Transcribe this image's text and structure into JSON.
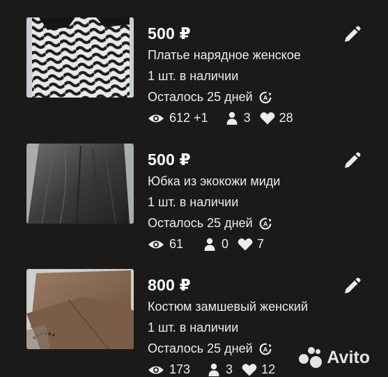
{
  "listings": [
    {
      "price": "500 ₽",
      "title": "Платье нарядное женское",
      "stock": "1 шт. в наличии",
      "remaining": "Осталось 25 дней",
      "views": "612 +1",
      "contacts": "3",
      "favorites": "28",
      "photo": "black-white-wave-dress-photo"
    },
    {
      "price": "500 ₽",
      "title": "Юбка из экокожи миди",
      "stock": "1 шт. в наличии",
      "remaining": "Осталось 25 дней",
      "views": "61",
      "contacts": "0",
      "favorites": "7",
      "photo": "leather-skirt-photo"
    },
    {
      "price": "800 ₽",
      "title": "Костюм замшевый женский",
      "stock": "1 шт. в наличии",
      "remaining": "Осталось 25 дней",
      "views": "173",
      "contacts": "3",
      "favorites": "12",
      "photo": "brown-suede-suit-photo"
    }
  ],
  "icons": {
    "edit": "pencil-icon",
    "autorenew": "auto-renew-icon",
    "views": "eye-icon",
    "contacts": "person-icon",
    "favorites": "heart-icon"
  },
  "watermark": "Avito",
  "colors": {
    "background": "#1b1a19",
    "text": "#f2f2f2"
  }
}
